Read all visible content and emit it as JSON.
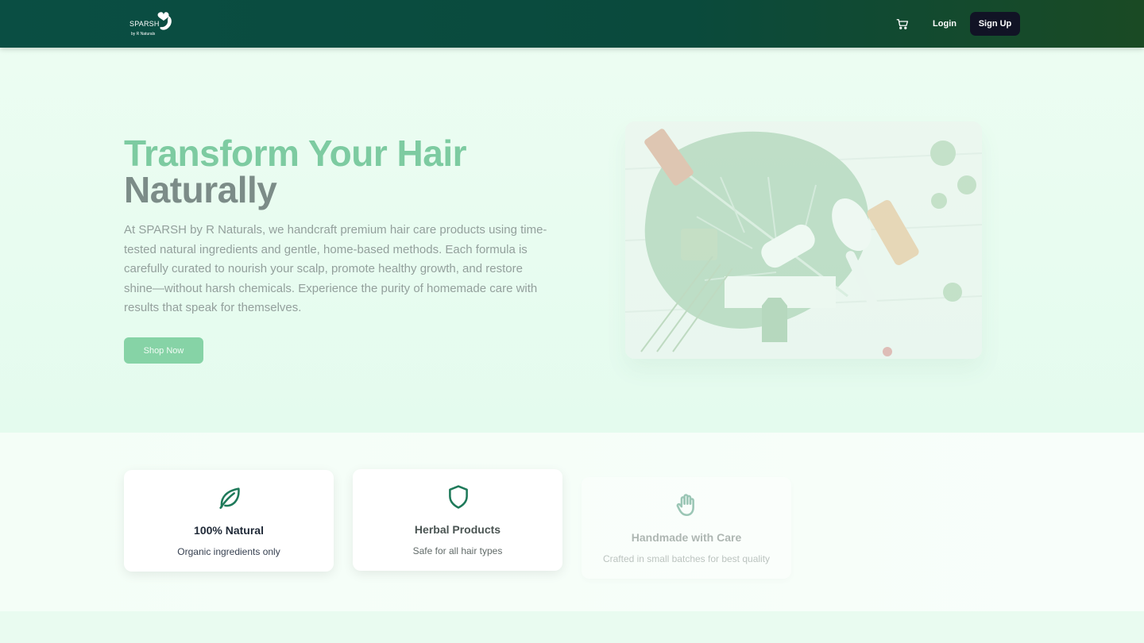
{
  "header": {
    "logo": {
      "brand": "SPARSH",
      "sub": "by R Naturals"
    },
    "cart_icon": "shopping-cart-icon",
    "login_label": "Login",
    "signup_label": "Sign Up"
  },
  "hero": {
    "title_line1": "Transform Your Hair",
    "title_line2": "Naturally",
    "description": "At SPARSH by R Naturals, we handcraft premium hair care products using time-tested natural ingredients and gentle, home-based methods. Each formula is carefully curated to nourish your scalp, promote healthy growth, and restore shine—without harsh chemicals. Experience the purity of homemade care with results that speak for themselves.",
    "cta_label": "Shop Now"
  },
  "features": [
    {
      "icon": "leaf-icon",
      "title": "100% Natural",
      "desc": "Organic ingredients only"
    },
    {
      "icon": "shield-icon",
      "title": "Herbal Products",
      "desc": "Safe for all hair types"
    },
    {
      "icon": "hand-icon",
      "title": "Handmade with Care",
      "desc": "Crafted in small batches for best quality"
    }
  ],
  "colors": {
    "header_bg": "#0a4e43",
    "accent_green": "#7dcba1",
    "icon_green": "#1f7a5a",
    "signup_bg": "#111325"
  }
}
